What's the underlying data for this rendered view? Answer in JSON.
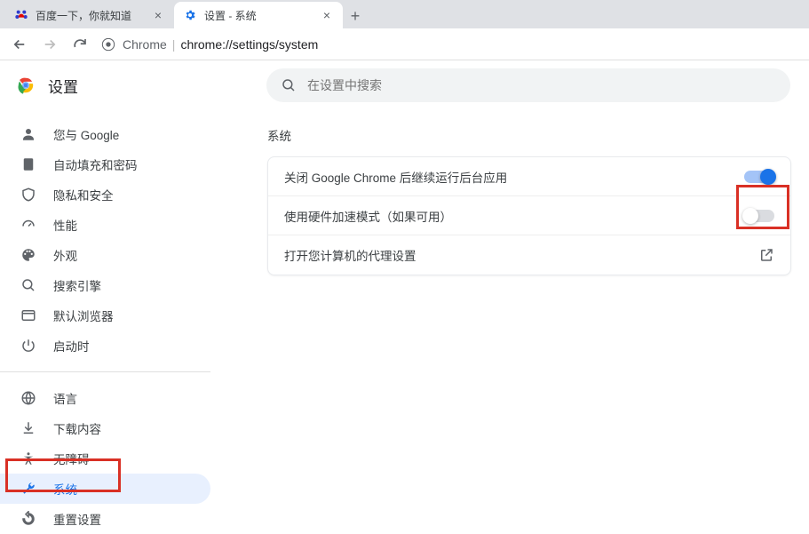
{
  "tabs": [
    {
      "title": "百度一下，你就知道"
    },
    {
      "title": "设置 - 系统"
    }
  ],
  "toolbar": {
    "chrome_label": "Chrome",
    "url_path": "chrome://settings/system"
  },
  "header": {
    "title": "设置",
    "search_placeholder": "在设置中搜索"
  },
  "sidebar": {
    "items_top": [
      {
        "id": "you-google",
        "label": "您与 Google"
      },
      {
        "id": "autofill",
        "label": "自动填充和密码"
      },
      {
        "id": "privacy",
        "label": "隐私和安全"
      },
      {
        "id": "performance",
        "label": "性能"
      },
      {
        "id": "appearance",
        "label": "外观"
      },
      {
        "id": "search-engine",
        "label": "搜索引擎"
      },
      {
        "id": "default-browser",
        "label": "默认浏览器"
      },
      {
        "id": "on-startup",
        "label": "启动时"
      }
    ],
    "items_bottom": [
      {
        "id": "languages",
        "label": "语言"
      },
      {
        "id": "downloads",
        "label": "下载内容"
      },
      {
        "id": "accessibility",
        "label": "无障碍"
      },
      {
        "id": "system",
        "label": "系统"
      },
      {
        "id": "reset",
        "label": "重置设置"
      }
    ]
  },
  "main": {
    "section_label": "系统",
    "rows": [
      {
        "label": "关闭 Google Chrome 后继续运行后台应用",
        "control": "toggle",
        "value": true
      },
      {
        "label": "使用硬件加速模式（如果可用）",
        "control": "toggle",
        "value": false
      },
      {
        "label": "打开您计算机的代理设置",
        "control": "external"
      }
    ]
  }
}
